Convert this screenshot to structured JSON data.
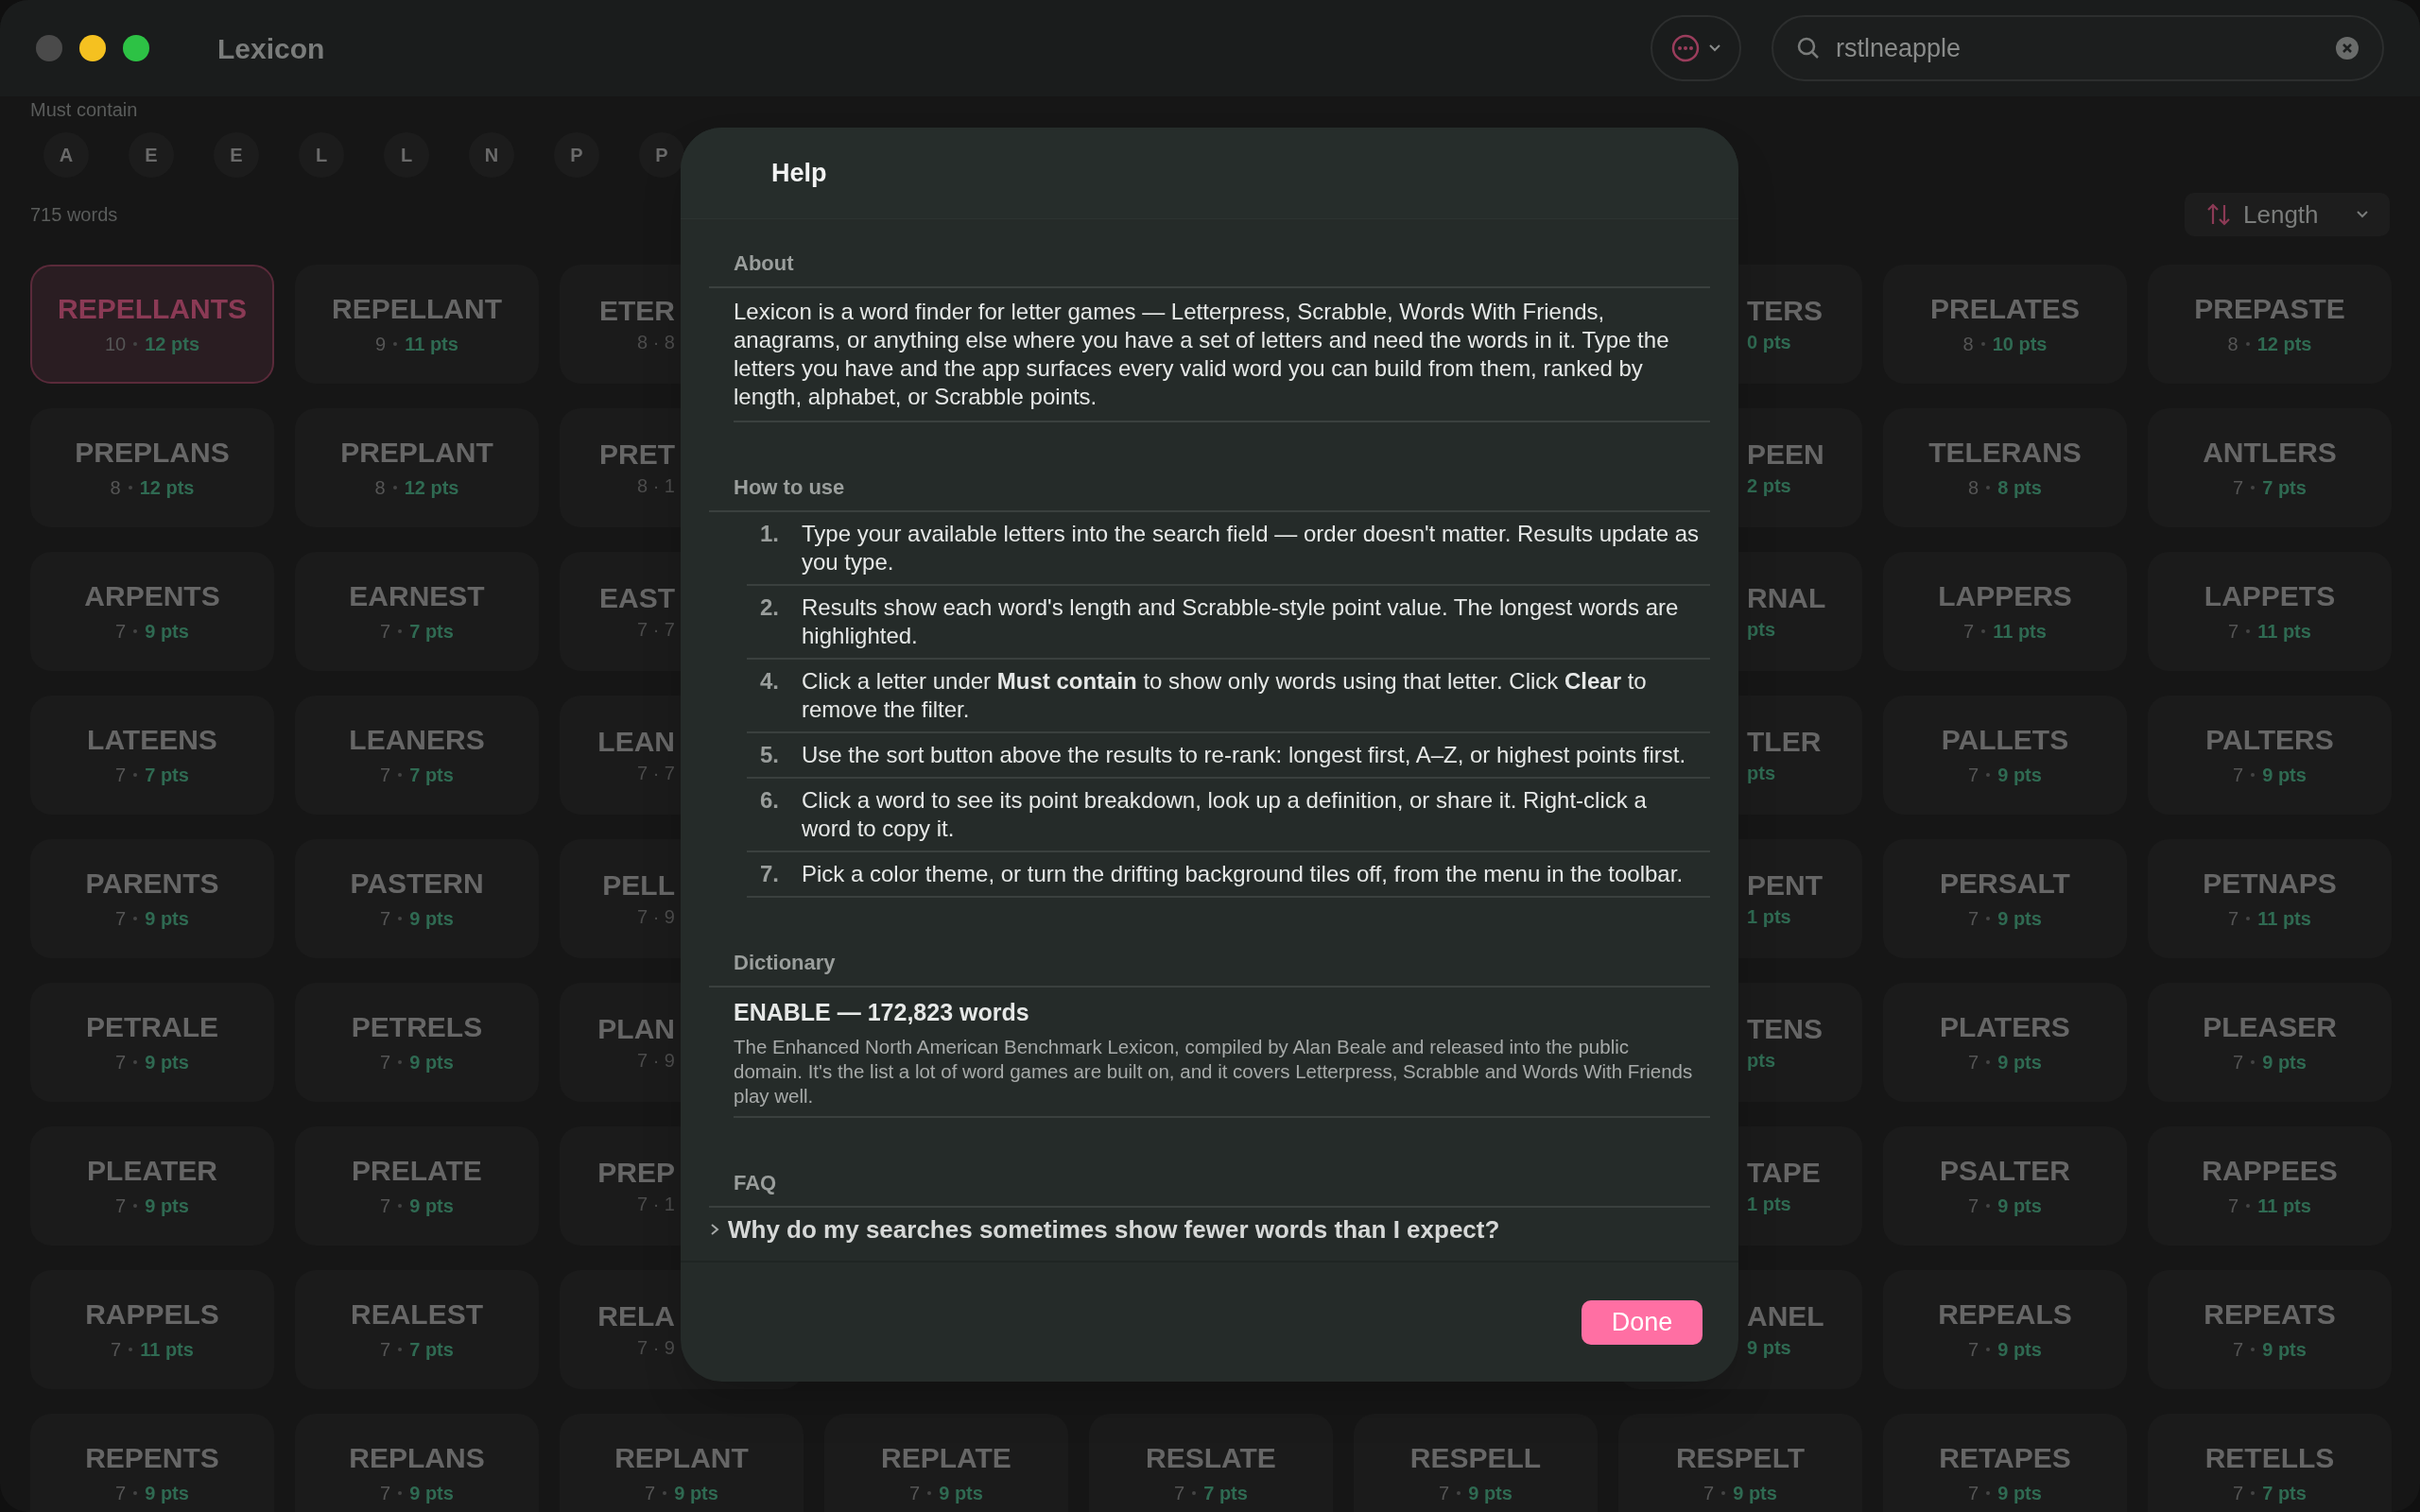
{
  "window": {
    "title": "Lexicon"
  },
  "search": {
    "value": "rstlneapple"
  },
  "filter": {
    "label": "Must contain",
    "letters": [
      "A",
      "E",
      "E",
      "L",
      "L",
      "N",
      "P",
      "P"
    ]
  },
  "results": {
    "count": "715 words",
    "sort": {
      "label": "Length"
    },
    "rows": [
      [
        {
          "kind": "full",
          "word": "REPELLANTS",
          "length": "10",
          "points": "12 pts",
          "selected": true
        },
        {
          "kind": "full",
          "word": "REPELLANT",
          "length": "9",
          "points": "11 pts",
          "selected": false
        },
        {
          "kind": "cut-right",
          "word": "ETER",
          "meta": "8 · 8",
          "selected": false
        },
        {
          "kind": "cut-left",
          "word": "TERS",
          "meta": "0 pts",
          "selected": false
        },
        {
          "kind": "full",
          "word": "PRELATES",
          "length": "8",
          "points": "10 pts",
          "selected": false
        },
        {
          "kind": "full",
          "word": "PREPASTE",
          "length": "8",
          "points": "12 pts",
          "selected": false
        }
      ],
      [
        {
          "kind": "full",
          "word": "PREPLANS",
          "length": "8",
          "points": "12 pts",
          "selected": false
        },
        {
          "kind": "full",
          "word": "PREPLANT",
          "length": "8",
          "points": "12 pts",
          "selected": false
        },
        {
          "kind": "cut-right",
          "word": "PRET",
          "meta": "8 · 1",
          "selected": false
        },
        {
          "kind": "cut-left",
          "word": "PEEN",
          "meta": "2 pts",
          "selected": false
        },
        {
          "kind": "full",
          "word": "TELERANS",
          "length": "8",
          "points": "8 pts",
          "selected": false
        },
        {
          "kind": "full",
          "word": "ANTLERS",
          "length": "7",
          "points": "7 pts",
          "selected": false
        }
      ],
      [
        {
          "kind": "full",
          "word": "ARPENTS",
          "length": "7",
          "points": "9 pts",
          "selected": false
        },
        {
          "kind": "full",
          "word": "EARNEST",
          "length": "7",
          "points": "7 pts",
          "selected": false
        },
        {
          "kind": "cut-right",
          "word": "EAST",
          "meta": "7 · 7",
          "selected": false
        },
        {
          "kind": "cut-left",
          "word": "RNAL",
          "meta": "pts",
          "selected": false
        },
        {
          "kind": "full",
          "word": "LAPPERS",
          "length": "7",
          "points": "11 pts",
          "selected": false
        },
        {
          "kind": "full",
          "word": "LAPPETS",
          "length": "7",
          "points": "11 pts",
          "selected": false
        }
      ],
      [
        {
          "kind": "full",
          "word": "LATEENS",
          "length": "7",
          "points": "7 pts",
          "selected": false
        },
        {
          "kind": "full",
          "word": "LEANERS",
          "length": "7",
          "points": "7 pts",
          "selected": false
        },
        {
          "kind": "cut-right",
          "word": "LEAN",
          "meta": "7 · 7",
          "selected": false
        },
        {
          "kind": "cut-left",
          "word": "TLER",
          "meta": "pts",
          "selected": false
        },
        {
          "kind": "full",
          "word": "PALLETS",
          "length": "7",
          "points": "9 pts",
          "selected": false
        },
        {
          "kind": "full",
          "word": "PALTERS",
          "length": "7",
          "points": "9 pts",
          "selected": false
        }
      ],
      [
        {
          "kind": "full",
          "word": "PARENTS",
          "length": "7",
          "points": "9 pts",
          "selected": false
        },
        {
          "kind": "full",
          "word": "PASTERN",
          "length": "7",
          "points": "9 pts",
          "selected": false
        },
        {
          "kind": "cut-right",
          "word": "PELL",
          "meta": "7 · 9",
          "selected": false
        },
        {
          "kind": "cut-left",
          "word": "PENT",
          "meta": "1 pts",
          "selected": false
        },
        {
          "kind": "full",
          "word": "PERSALT",
          "length": "7",
          "points": "9 pts",
          "selected": false
        },
        {
          "kind": "full",
          "word": "PETNAPS",
          "length": "7",
          "points": "11 pts",
          "selected": false
        }
      ],
      [
        {
          "kind": "full",
          "word": "PETRALE",
          "length": "7",
          "points": "9 pts",
          "selected": false
        },
        {
          "kind": "full",
          "word": "PETRELS",
          "length": "7",
          "points": "9 pts",
          "selected": false
        },
        {
          "kind": "cut-right",
          "word": "PLAN",
          "meta": "7 · 9",
          "selected": false
        },
        {
          "kind": "cut-left",
          "word": "TENS",
          "meta": "pts",
          "selected": false
        },
        {
          "kind": "full",
          "word": "PLATERS",
          "length": "7",
          "points": "9 pts",
          "selected": false
        },
        {
          "kind": "full",
          "word": "PLEASER",
          "length": "7",
          "points": "9 pts",
          "selected": false
        }
      ],
      [
        {
          "kind": "full",
          "word": "PLEATER",
          "length": "7",
          "points": "9 pts",
          "selected": false
        },
        {
          "kind": "full",
          "word": "PRELATE",
          "length": "7",
          "points": "9 pts",
          "selected": false
        },
        {
          "kind": "cut-right",
          "word": "PREP",
          "meta": "7 · 1",
          "selected": false
        },
        {
          "kind": "cut-left",
          "word": "TAPE",
          "meta": "1 pts",
          "selected": false
        },
        {
          "kind": "full",
          "word": "PSALTER",
          "length": "7",
          "points": "9 pts",
          "selected": false
        },
        {
          "kind": "full",
          "word": "RAPPEES",
          "length": "7",
          "points": "11 pts",
          "selected": false
        }
      ],
      [
        {
          "kind": "full",
          "word": "RAPPELS",
          "length": "7",
          "points": "11 pts",
          "selected": false
        },
        {
          "kind": "full",
          "word": "REALEST",
          "length": "7",
          "points": "7 pts",
          "selected": false
        },
        {
          "kind": "cut-right",
          "word": "RELA",
          "meta": "7 · 9",
          "selected": false
        },
        {
          "kind": "cut-left",
          "word": "ANEL",
          "meta": "9 pts",
          "selected": false
        },
        {
          "kind": "full",
          "word": "REPEALS",
          "length": "7",
          "points": "9 pts",
          "selected": false
        },
        {
          "kind": "full",
          "word": "REPEATS",
          "length": "7",
          "points": "9 pts",
          "selected": false
        }
      ],
      [
        {
          "kind": "full",
          "word": "REPENTS",
          "length": "7",
          "points": "9 pts",
          "selected": false
        },
        {
          "kind": "full",
          "word": "REPLANS",
          "length": "7",
          "points": "9 pts",
          "selected": false
        },
        {
          "kind": "full",
          "word": "REPLANT",
          "length": "7",
          "points": "9 pts",
          "selected": false
        },
        {
          "kind": "full",
          "word": "REPLATE",
          "length": "7",
          "points": "9 pts",
          "selected": false
        },
        {
          "kind": "full",
          "word": "RESLATE",
          "length": "7",
          "points": "7 pts",
          "selected": false
        },
        {
          "kind": "full",
          "word": "RESPELL",
          "length": "7",
          "points": "9 pts",
          "selected": false
        },
        {
          "kind": "full",
          "word": "RESPELT",
          "length": "7",
          "points": "9 pts",
          "selected": false
        },
        {
          "kind": "full",
          "word": "RETAPES",
          "length": "7",
          "points": "9 pts",
          "selected": false
        },
        {
          "kind": "full",
          "word": "RETELLS",
          "length": "7",
          "points": "7 pts",
          "selected": false
        }
      ]
    ]
  },
  "help": {
    "title": "Help",
    "sections": [
      {
        "kind": "text",
        "heading": "About",
        "body": "Lexicon is a word finder for letter games — Letterpress, Scrabble, Words With Friends, anagrams, or anything else where you have a set of letters and need the words in it. Type the letters you have and the app surfaces every valid word you can build from them, ranked by length, alphabet, or Scrabble points."
      },
      {
        "kind": "steps",
        "heading": "How to use",
        "steps": [
          {
            "number": "1.",
            "text": "Type your available letters into the search field — order doesn't matter. Results update as you type."
          },
          {
            "number": "2.",
            "text": "Results show each word's length and Scrabble-style point value. The longest words are highlighted."
          },
          {
            "number": "4.",
            "text": "Click a letter under **Must contain** to show only words using that letter. Click **Clear** to remove the filter."
          },
          {
            "number": "5.",
            "text": "Use the sort button above the results to re-rank: longest first, A–Z, or highest points first."
          },
          {
            "number": "6.",
            "text": "Click a word to see its point breakdown, look up a definition, or share it. Right-click a word to copy it."
          },
          {
            "number": "7.",
            "text": "Pick a color theme, or turn the drifting background tiles off, from the menu in the toolbar."
          }
        ]
      },
      {
        "kind": "dictionary",
        "heading": "Dictionary",
        "name": "ENABLE — 172,823 words",
        "body": "The Enhanced North American Benchmark Lexicon, compiled by Alan Beale and released into the public domain. It's the list a lot of word games are built on, and it covers Letterpress, Scrabble and Words With Friends play well."
      },
      {
        "kind": "faq",
        "heading": "FAQ",
        "questions": [
          "Why do my searches sometimes show fewer words than I expect?"
        ]
      }
    ],
    "done": "Done"
  }
}
